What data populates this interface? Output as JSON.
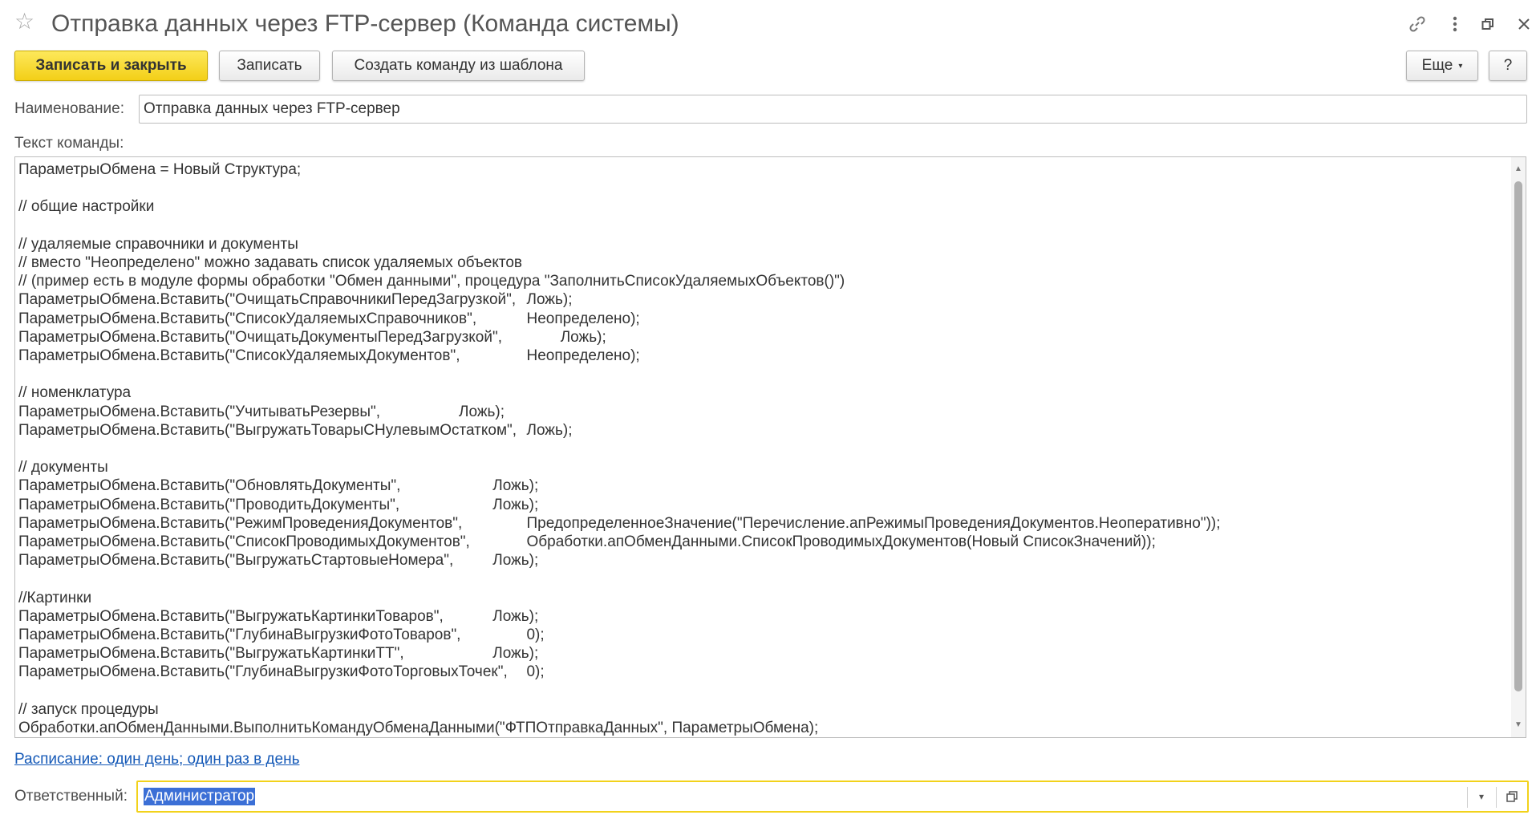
{
  "header": {
    "title": "Отправка данных через FTP-сервер (Команда системы)",
    "star_icon": "star-icon",
    "link_icon": "link-icon",
    "more_icon": "vertical-dots-icon",
    "restore_icon": "restore-window-icon",
    "close_icon": "close-icon"
  },
  "toolbar": {
    "save_close_label": "Записать и закрыть",
    "save_label": "Записать",
    "create_from_template_label": "Создать команду из шаблона",
    "more_label": "Еще",
    "help_label": "?"
  },
  "form": {
    "name_label": "Наименование:",
    "name_value": "Отправка данных через FTP-сервер",
    "command_text_label": "Текст команды:",
    "command_text": "ПараметрыОбмена = Новый Структура;\n\n// общие настройки\n\n// удаляемые справочники и документы\n// вместо \"Неопределено\" можно задавать список удаляемых объектов\n// (пример есть в модуле формы обработки \"Обмен данными\", процедура \"ЗаполнитьСписокУдаляемыхОбъектов()\")\nПараметрыОбмена.Вставить(\"ОчищатьСправочникиПередЗагрузкой\",\tЛожь);\nПараметрыОбмена.Вставить(\"СписокУдаляемыхСправочников\",\t\tНеопределено);\nПараметрыОбмена.Вставить(\"ОчищатьДокументыПередЗагрузкой\",\t\tЛожь);\nПараметрыОбмена.Вставить(\"СписокУдаляемыхДокументов\",\t\tНеопределено);\n\n// номенклатура\nПараметрыОбмена.Вставить(\"УчитыватьРезервы\",\t\t\tЛожь);\nПараметрыОбмена.Вставить(\"ВыгружатьТоварыСНулевымОстатком\",\tЛожь);\n\n// документы\nПараметрыОбмена.Вставить(\"ОбновлятьДокументы\",\t\t\tЛожь);\nПараметрыОбмена.Вставить(\"ПроводитьДокументы\",\t\t\tЛожь);\nПараметрыОбмена.Вставить(\"РежимПроведенияДокументов\",\t\tПредопределенноеЗначение(\"Перечисление.апРежимыПроведенияДокументов.Неоперативно\"));\nПараметрыОбмена.Вставить(\"СписокПроводимыхДокументов\",\t\tОбработки.апОбменДанными.СписокПроводимыхДокументов(Новый СписокЗначений));\nПараметрыОбмена.Вставить(\"ВыгружатьСтартовыеНомера\",\t\tЛожь);\n\n//Картинки\nПараметрыОбмена.Вставить(\"ВыгружатьКартинкиТоваров\",\t\tЛожь);\nПараметрыОбмена.Вставить(\"ГлубинаВыгрузкиФотоТоваров\",\t\t0);\nПараметрыОбмена.Вставить(\"ВыгружатьКартинкиТТ\",\t\t\tЛожь);\nПараметрыОбмена.Вставить(\"ГлубинаВыгрузкиФотоТорговыхТочек\",\t0);\n\n// запуск процедуры\nОбработки.апОбменДанными.ВыполнитьКомандуОбменаДанными(\"ФТПОтправкаДанных\", ПараметрыОбмена);",
    "schedule_link": "Расписание: один день; один раз в день",
    "responsible_label": "Ответственный:",
    "responsible_value": "Администратор"
  },
  "colors": {
    "primary_button": "#f3cf17",
    "link": "#1559b7",
    "active_field_border": "#f2d21b",
    "selection": "#3b6fd6"
  }
}
